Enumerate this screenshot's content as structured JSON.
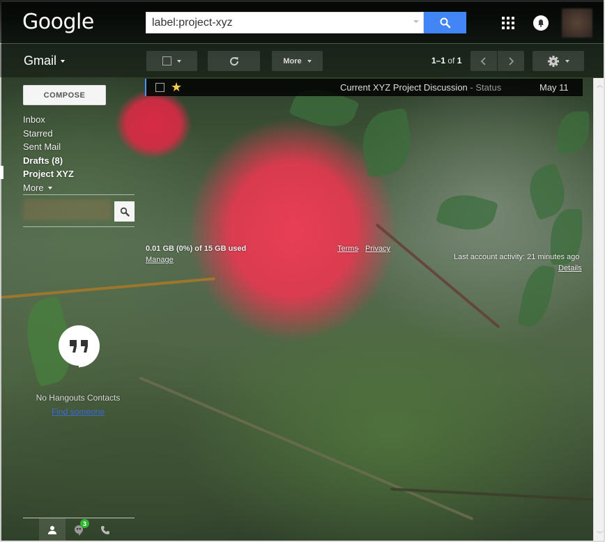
{
  "header": {
    "logo": "Google",
    "search": {
      "value": "label:project-xyz",
      "placeholder": ""
    },
    "icons": [
      "search-icon",
      "apps-grid-icon",
      "notifications-bell-icon",
      "account-avatar"
    ]
  },
  "toolbar": {
    "app_label": "Gmail",
    "select_icon": "checkbox-icon",
    "refresh_icon": "refresh-icon",
    "more_label": "More",
    "pagination": {
      "range": "1–1",
      "of_label": "of",
      "total": "1"
    },
    "settings_icon": "gear-icon"
  },
  "sidebar": {
    "compose_label": "COMPOSE",
    "items": [
      {
        "label": "Inbox",
        "bold": false
      },
      {
        "label": "Starred",
        "bold": false
      },
      {
        "label": "Sent Mail",
        "bold": false
      },
      {
        "label": "Drafts (8)",
        "bold": true
      },
      {
        "label": "Project XYZ",
        "bold": true,
        "active": true
      }
    ],
    "more_label": "More",
    "hangouts": {
      "empty_text": "No Hangouts Contacts",
      "find_link": "Find someone"
    },
    "bottom_tabs": [
      {
        "icon": "contacts-person-icon",
        "active": true
      },
      {
        "icon": "hangouts-chat-icon",
        "badge": "3"
      },
      {
        "icon": "phone-icon"
      }
    ]
  },
  "mail_list": {
    "rows": [
      {
        "starred": true,
        "subject": "Current XYZ Project Discussion",
        "separator": " - ",
        "snippet": "Status",
        "date": "May 11"
      }
    ]
  },
  "footer": {
    "storage": "0.01 GB (0%) of 15 GB used",
    "manage_link": "Manage",
    "terms_link": "Terms",
    "separator": " - ",
    "privacy_link": "Privacy",
    "last_activity": "Last account activity: 21 minutes ago",
    "details_link": "Details"
  },
  "colors": {
    "search_button": "#4285f4",
    "star": "#f7cb4d",
    "badge": "#2eb82e",
    "link_blue": "#3b6bd6",
    "selected_row_border": "#4d90fe"
  }
}
